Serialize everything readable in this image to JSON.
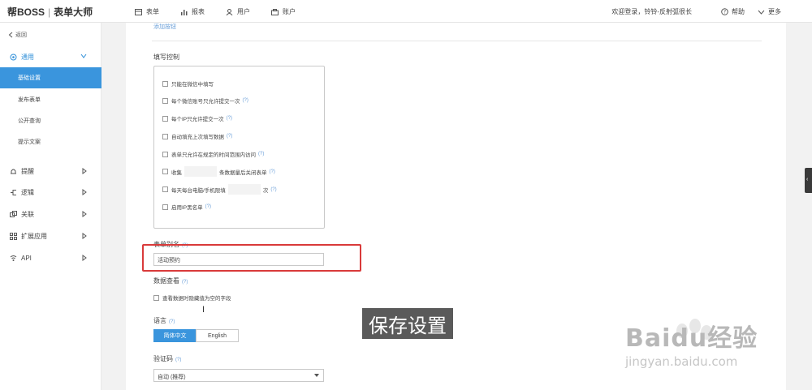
{
  "header": {
    "brand": "帮BOSS",
    "product": "表单大师",
    "nav": [
      {
        "label": "表单",
        "icon": "form-icon"
      },
      {
        "label": "报表",
        "icon": "report-icon"
      },
      {
        "label": "用户",
        "icon": "user-icon"
      },
      {
        "label": "账户",
        "icon": "account-icon"
      }
    ],
    "welcome": "欢迎登录，铃铃-反射弧很长",
    "help": "帮助",
    "more": "更多"
  },
  "sidebar": {
    "back": "返回",
    "general": "通用",
    "sub_items": [
      "基础设置",
      "发布表单",
      "公开查询",
      "提示文案"
    ],
    "groups": [
      {
        "label": "提醒",
        "icon": "bell-icon"
      },
      {
        "label": "逻辑",
        "icon": "logic-icon"
      },
      {
        "label": "关联",
        "icon": "link-icon"
      },
      {
        "label": "扩展应用",
        "icon": "apps-icon"
      },
      {
        "label": "API",
        "icon": "api-icon"
      }
    ]
  },
  "main": {
    "top_link": "添加按钮",
    "fill_control": {
      "title": "填写控制",
      "options": [
        {
          "label": "只能在微信中填写",
          "help": ""
        },
        {
          "label": "每个微信账号只允许提交一次",
          "help": "(?)"
        },
        {
          "label": "每个IP只允许提交一次",
          "help": "(?)"
        },
        {
          "label": "自动填充上次填写数据",
          "help": "(?)"
        },
        {
          "label": "表单只允许在规定的时间范围内访问",
          "help": "(?)"
        },
        {
          "label_prefix": "收集",
          "label_suffix": "条数据量后关闭表单",
          "help": "(?)"
        },
        {
          "label_prefix": "每天每台电脑/手机限填",
          "label_suffix": "次",
          "help": "(?)"
        },
        {
          "label": "启用IP黑名单",
          "help": "(?)"
        }
      ]
    },
    "alias": {
      "title": "表单别名",
      "help": "(?)",
      "value": "活动预约"
    },
    "data_view": {
      "title": "数据查看",
      "help": "(?)",
      "option": "查看数据时隐藏值为空的字段"
    },
    "language": {
      "title": "语言",
      "help": "(?)",
      "options": [
        "简体中文",
        "English"
      ],
      "selected": "简体中文"
    },
    "captcha": {
      "title": "验证码",
      "help": "(?)",
      "value": "自动 (推荐)"
    }
  },
  "overlay": {
    "caption": "保存设置",
    "watermark_brand": "Baidu经验",
    "watermark_url": "jingyan.baidu.com"
  },
  "colors": {
    "accent": "#3a95dd",
    "highlight_box": "#d93a3a"
  }
}
